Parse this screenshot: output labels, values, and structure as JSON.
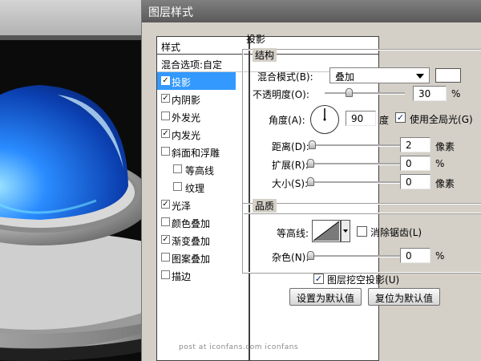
{
  "dialog": {
    "title": "图层样式"
  },
  "sidebar": {
    "header": "样式",
    "blend_options": "混合选项:自定",
    "items": [
      {
        "label": "投影",
        "checked": true,
        "selected": true,
        "indent": false
      },
      {
        "label": "内阴影",
        "checked": true,
        "selected": false,
        "indent": false
      },
      {
        "label": "外发光",
        "checked": false,
        "selected": false,
        "indent": false
      },
      {
        "label": "内发光",
        "checked": true,
        "selected": false,
        "indent": false
      },
      {
        "label": "斜面和浮雕",
        "checked": false,
        "selected": false,
        "indent": false
      },
      {
        "label": "等高线",
        "checked": false,
        "selected": false,
        "indent": true
      },
      {
        "label": "纹理",
        "checked": false,
        "selected": false,
        "indent": true
      },
      {
        "label": "光泽",
        "checked": true,
        "selected": false,
        "indent": false
      },
      {
        "label": "颜色叠加",
        "checked": false,
        "selected": false,
        "indent": false
      },
      {
        "label": "渐变叠加",
        "checked": true,
        "selected": false,
        "indent": false
      },
      {
        "label": "图案叠加",
        "checked": false,
        "selected": false,
        "indent": false
      },
      {
        "label": "描边",
        "checked": false,
        "selected": false,
        "indent": false
      }
    ]
  },
  "drop_shadow": {
    "section_title": "投影",
    "structure": {
      "title": "结构",
      "blend_mode": {
        "label": "混合模式",
        "hotkey": "(B)",
        "value": "叠加",
        "color": "#ffffff"
      },
      "opacity": {
        "label": "不透明度",
        "hotkey": "(O)",
        "value": "30",
        "unit": "%"
      },
      "angle": {
        "label": "角度",
        "hotkey": "(A)",
        "value": "90",
        "unit": "度",
        "global_light_label": "使用全局光",
        "global_light_hotkey": "(G)",
        "global_light_checked": true
      },
      "distance": {
        "label": "距离",
        "hotkey": "(D)",
        "value": "2",
        "unit": "像素"
      },
      "spread": {
        "label": "扩展",
        "hotkey": "(R)",
        "value": "0",
        "unit": "%"
      },
      "size": {
        "label": "大小",
        "hotkey": "(S)",
        "value": "0",
        "unit": "像素"
      }
    },
    "quality": {
      "title": "品质",
      "contour_label": "等高线",
      "anti_alias_label": "消除锯齿",
      "anti_alias_hotkey": "(L)",
      "anti_alias_checked": false,
      "noise": {
        "label": "杂色",
        "hotkey": "(N)",
        "value": "0",
        "unit": "%"
      }
    },
    "knockout_label": "图层挖空投影",
    "knockout_hotkey": "(U)",
    "knockout_checked": true,
    "make_default_label": "设置为默认值",
    "reset_default_label": "复位为默认值"
  },
  "watermark": "post at iconfans.com  iconfans",
  "icons": {
    "check": "✓",
    "dropdown": "dropdown-arrow-icon"
  }
}
